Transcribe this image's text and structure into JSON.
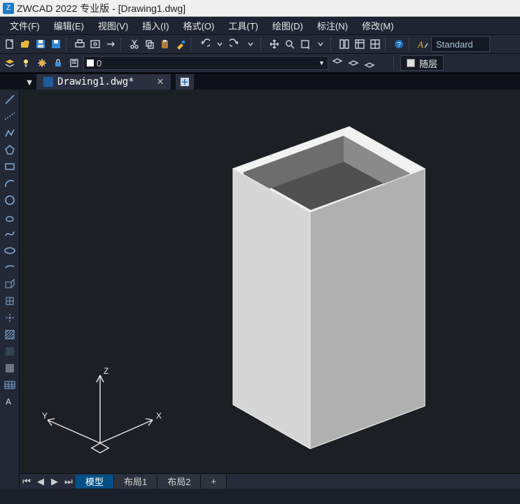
{
  "app": {
    "title": "ZWCAD 2022 专业版 - [Drawing1.dwg]"
  },
  "menu": {
    "file": "文件(F)",
    "edit": "编辑(E)",
    "view": "视图(V)",
    "insert": "插入(I)",
    "format": "格式(O)",
    "tools": "工具(T)",
    "draw": "绘图(D)",
    "dim": "标注(N)",
    "modify": "修改(M)"
  },
  "style": {
    "current": "Standard"
  },
  "layer": {
    "current_name": "0",
    "bylayer_label": "随层"
  },
  "doctab": {
    "name": "Drawing1.dwg*"
  },
  "axes": {
    "x": "X",
    "y": "Y",
    "z": "Z"
  },
  "layouts": {
    "model": "模型",
    "l1": "布局1",
    "l2": "布局2",
    "plus": "+"
  }
}
